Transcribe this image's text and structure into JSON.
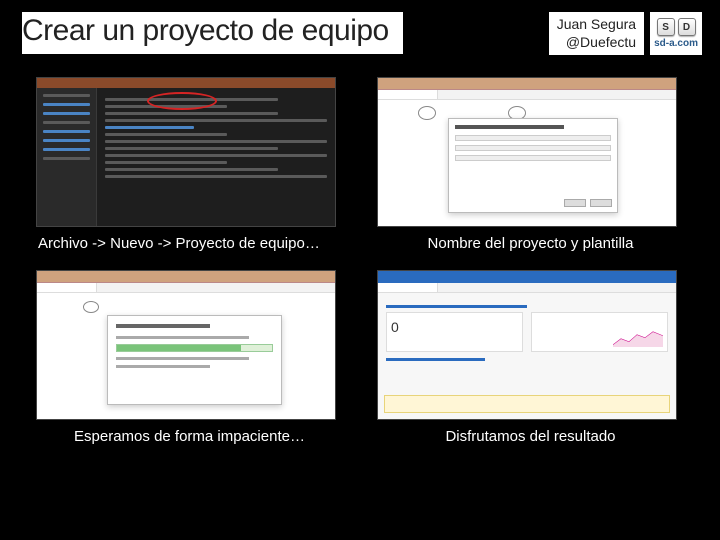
{
  "header": {
    "title": "Crear un proyecto de equipo",
    "author_name": "Juan Segura",
    "author_handle": "@Duefectu",
    "badge_key1": "S",
    "badge_key2": "D",
    "badge_text": "sd-a.com"
  },
  "captions": {
    "c1": "Archivo -> Nuevo -> Proyecto de equipo…",
    "c2": "Nombre del proyecto y plantilla",
    "c3": "Esperamos de forma impaciente…",
    "c4": "Disfrutamos del resultado"
  },
  "t4": {
    "big_number": "0"
  }
}
